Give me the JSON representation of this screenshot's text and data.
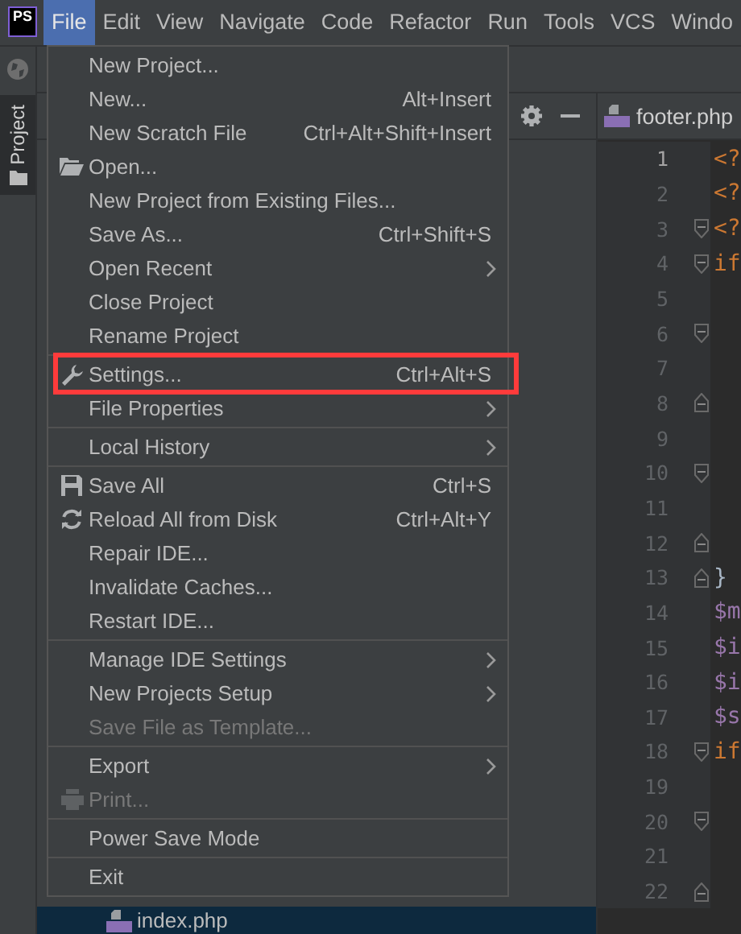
{
  "logo": {
    "text": "PS"
  },
  "menubar": [
    {
      "label": "File",
      "selected": true
    },
    {
      "label": "Edit",
      "selected": false
    },
    {
      "label": "View",
      "selected": false
    },
    {
      "label": "Navigate",
      "selected": false
    },
    {
      "label": "Code",
      "selected": false
    },
    {
      "label": "Refactor",
      "selected": false
    },
    {
      "label": "Run",
      "selected": false
    },
    {
      "label": "Tools",
      "selected": false
    },
    {
      "label": "VCS",
      "selected": false
    },
    {
      "label": "Windo",
      "selected": false
    }
  ],
  "tool_window_tab": {
    "label": "Project",
    "selected": true
  },
  "project_tree": [
    {
      "label": "index.php",
      "selected": true
    }
  ],
  "editor_tab": {
    "label": "footer.php",
    "selected": true
  },
  "code_lines": [
    {
      "number": "1",
      "text": "<?",
      "kind": "tag",
      "current": true,
      "fold_start": false,
      "fold_end": false
    },
    {
      "number": "2",
      "text": "<?",
      "kind": "tag",
      "current": false,
      "fold_start": false,
      "fold_end": false
    },
    {
      "number": "3",
      "text": "<?",
      "kind": "tag",
      "current": false,
      "fold_start": true,
      "fold_end": false
    },
    {
      "number": "4",
      "text": "if",
      "kind": "keyword",
      "current": false,
      "fold_start": true,
      "fold_end": false
    },
    {
      "number": "5",
      "current": false,
      "fold_start": false,
      "fold_end": false
    },
    {
      "number": "6",
      "current": false,
      "fold_start": true,
      "fold_end": false
    },
    {
      "number": "7",
      "current": false,
      "fold_start": false,
      "fold_end": false
    },
    {
      "number": "8",
      "current": false,
      "fold_start": false,
      "fold_end": true
    },
    {
      "number": "9",
      "current": false,
      "fold_start": false,
      "fold_end": false
    },
    {
      "number": "10",
      "current": false,
      "fold_start": true,
      "fold_end": false
    },
    {
      "number": "11",
      "current": false,
      "fold_start": false,
      "fold_end": false
    },
    {
      "number": "12",
      "current": false,
      "fold_start": false,
      "fold_end": true
    },
    {
      "number": "13",
      "text": "}",
      "kind": "plain",
      "current": false,
      "fold_start": false,
      "fold_end": true
    },
    {
      "number": "14",
      "text": "$m",
      "kind": "variable",
      "current": false,
      "fold_start": false,
      "fold_end": false
    },
    {
      "number": "15",
      "text": "$i",
      "kind": "variable",
      "current": false,
      "fold_start": false,
      "fold_end": false
    },
    {
      "number": "16",
      "text": "$i",
      "kind": "variable",
      "current": false,
      "fold_start": false,
      "fold_end": false
    },
    {
      "number": "17",
      "text": "$s",
      "kind": "variable",
      "current": false,
      "fold_start": false,
      "fold_end": false
    },
    {
      "number": "18",
      "text": "if",
      "kind": "keyword",
      "current": false,
      "fold_start": true,
      "fold_end": false
    },
    {
      "number": "19",
      "current": false,
      "fold_start": false,
      "fold_end": false
    },
    {
      "number": "20",
      "current": false,
      "fold_start": true,
      "fold_end": false
    },
    {
      "number": "21",
      "current": false,
      "fold_start": false,
      "fold_end": false
    },
    {
      "number": "22",
      "current": false,
      "fold_start": false,
      "fold_end": true
    }
  ],
  "file_menu": [
    [
      {
        "label": "New Project...",
        "submenu": false,
        "disabled": false,
        "highlighted": false
      },
      {
        "label": "New...",
        "shortcut": "Alt+Insert",
        "submenu": false,
        "disabled": false,
        "highlighted": false
      },
      {
        "label": "New Scratch File",
        "shortcut": "Ctrl+Alt+Shift+Insert",
        "submenu": false,
        "disabled": false,
        "highlighted": false
      },
      {
        "label": "Open...",
        "submenu": false,
        "disabled": false,
        "highlighted": false
      },
      {
        "label": "New Project from Existing Files...",
        "submenu": false,
        "disabled": false,
        "highlighted": false
      },
      {
        "label": "Save As...",
        "shortcut": "Ctrl+Shift+S",
        "submenu": false,
        "disabled": false,
        "highlighted": false
      },
      {
        "label": "Open Recent",
        "submenu": true,
        "disabled": false,
        "highlighted": false
      },
      {
        "label": "Close Project",
        "submenu": false,
        "disabled": false,
        "highlighted": false
      },
      {
        "label": "Rename Project",
        "submenu": false,
        "disabled": false,
        "highlighted": false
      }
    ],
    [
      {
        "label": "Settings...",
        "shortcut": "Ctrl+Alt+S",
        "submenu": false,
        "disabled": false,
        "highlighted": true
      },
      {
        "label": "File Properties",
        "submenu": true,
        "disabled": false,
        "highlighted": false
      }
    ],
    [
      {
        "label": "Local History",
        "submenu": true,
        "disabled": false,
        "highlighted": false
      }
    ],
    [
      {
        "label": "Save All",
        "shortcut": "Ctrl+S",
        "submenu": false,
        "disabled": false,
        "highlighted": false
      },
      {
        "label": "Reload All from Disk",
        "shortcut": "Ctrl+Alt+Y",
        "submenu": false,
        "disabled": false,
        "highlighted": false
      },
      {
        "label": "Repair IDE...",
        "submenu": false,
        "disabled": false,
        "highlighted": false
      },
      {
        "label": "Invalidate Caches...",
        "submenu": false,
        "disabled": false,
        "highlighted": false
      },
      {
        "label": "Restart IDE...",
        "submenu": false,
        "disabled": false,
        "highlighted": false
      }
    ],
    [
      {
        "label": "Manage IDE Settings",
        "submenu": true,
        "disabled": false,
        "highlighted": false
      },
      {
        "label": "New Projects Setup",
        "submenu": true,
        "disabled": false,
        "highlighted": false
      },
      {
        "label": "Save File as Template...",
        "submenu": false,
        "disabled": true,
        "highlighted": false
      }
    ],
    [
      {
        "label": "Export",
        "submenu": true,
        "disabled": false,
        "highlighted": false
      },
      {
        "label": "Print...",
        "submenu": false,
        "disabled": true,
        "highlighted": false
      }
    ],
    [
      {
        "label": "Power Save Mode",
        "submenu": false,
        "disabled": false,
        "highlighted": false
      }
    ],
    [
      {
        "label": "Exit",
        "submenu": false,
        "disabled": false,
        "highlighted": false
      }
    ]
  ]
}
